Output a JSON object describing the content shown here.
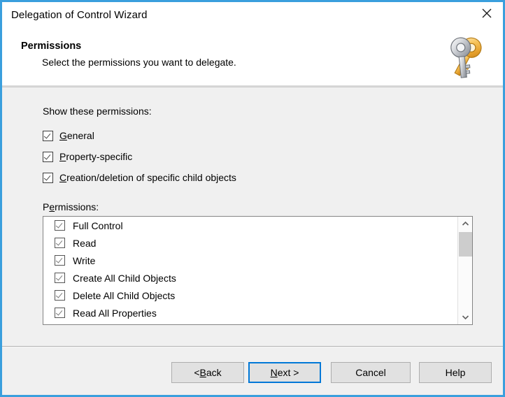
{
  "window": {
    "title": "Delegation of Control Wizard",
    "close_icon": "close-icon",
    "accent_color": "#3a9fdd"
  },
  "header": {
    "title": "Permissions",
    "subtitle": "Select the permissions you want to delegate.",
    "icon": "two-keys-icon"
  },
  "body": {
    "show_label": "Show these permissions:",
    "scope_checkboxes": [
      {
        "label_pre": "",
        "accel": "G",
        "label_post": "eneral",
        "checked": true
      },
      {
        "label_pre": "",
        "accel": "P",
        "label_post": "roperty-specific",
        "checked": true
      },
      {
        "label_pre": "",
        "accel": "C",
        "label_post": "reation/deletion of specific child objects",
        "checked": true
      }
    ],
    "permissions_label_pre": "P",
    "permissions_label_accel": "e",
    "permissions_label_post": "rmissions:",
    "permissions_list": [
      {
        "label": "Full Control",
        "checked": true
      },
      {
        "label": "Read",
        "checked": true
      },
      {
        "label": "Write",
        "checked": true
      },
      {
        "label": "Create All Child Objects",
        "checked": true
      },
      {
        "label": "Delete All Child Objects",
        "checked": true
      },
      {
        "label": "Read All Properties",
        "checked": true
      }
    ],
    "scrollbar": {
      "up_icon": "chevron-up-icon",
      "down_icon": "chevron-down-icon",
      "thumb": "scrollbar-thumb"
    }
  },
  "footer": {
    "back": {
      "pre": "< ",
      "accel": "B",
      "post": "ack"
    },
    "next": {
      "pre": "",
      "accel": "N",
      "post": "ext >"
    },
    "cancel": {
      "pre": "Cancel",
      "accel": "",
      "post": ""
    },
    "help": {
      "pre": "Help",
      "accel": "",
      "post": ""
    },
    "default_button": "next"
  }
}
